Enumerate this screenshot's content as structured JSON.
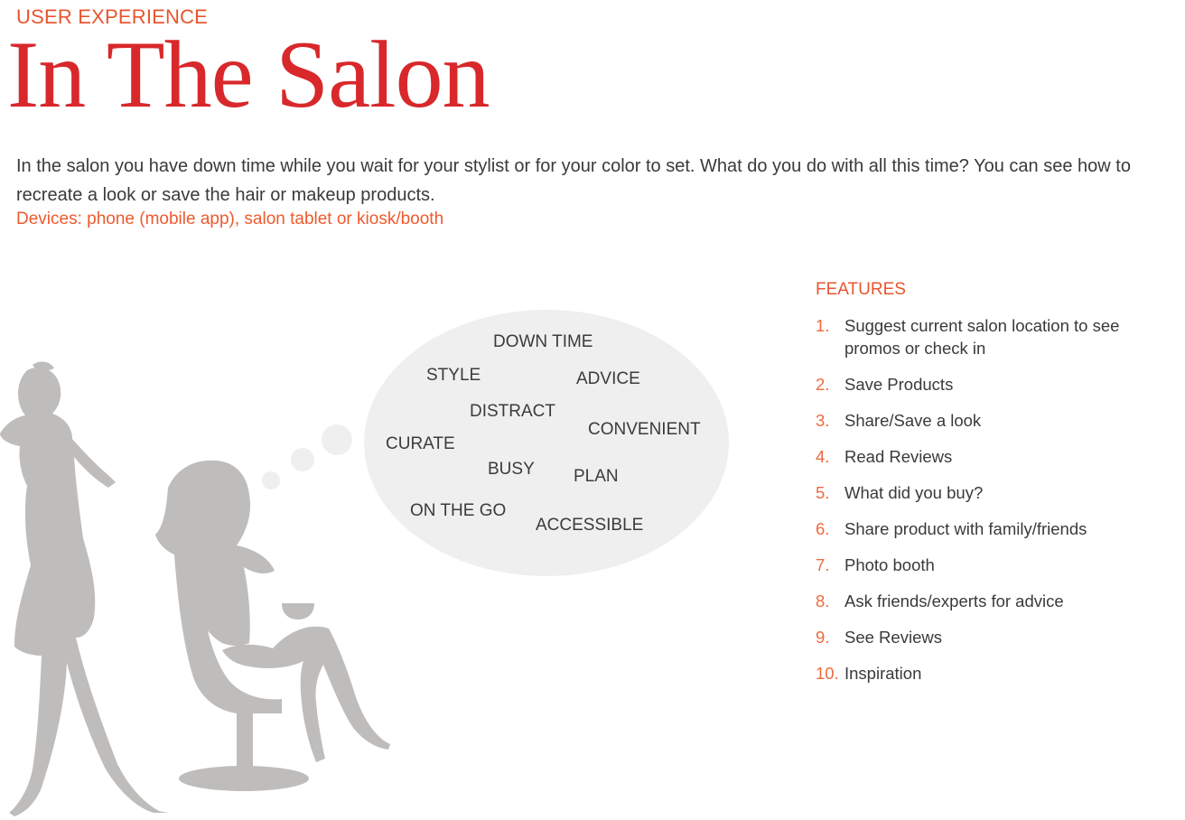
{
  "header": {
    "kicker": "USER EXPERIENCE",
    "title": "In The Salon"
  },
  "intro": {
    "text": "In the salon you have down time while you wait for your stylist or for your color to set. What do you do with all this time? You can see how to recreate a look or save the hair or makeup products.",
    "devices": "Devices: phone (mobile app), salon tablet or kiosk/booth"
  },
  "thought_bubble": {
    "words": [
      "DOWN TIME",
      "STYLE",
      "ADVICE",
      "DISTRACT",
      "CONVENIENT",
      "CURATE",
      "BUSY",
      "PLAN",
      "ON THE GO",
      "ACCESSIBLE"
    ]
  },
  "features": {
    "heading": "FEATURES",
    "items": [
      {
        "num": "1.",
        "text": "Suggest current salon location to see promos or check in"
      },
      {
        "num": "2.",
        "text": "Save Products"
      },
      {
        "num": "3.",
        "text": "Share/Save a look"
      },
      {
        "num": "4.",
        "text": "Read Reviews"
      },
      {
        "num": "5.",
        "text": "What did you buy?"
      },
      {
        "num": "6.",
        "text": "Share product with family/friends"
      },
      {
        "num": "7.",
        "text": "Photo booth"
      },
      {
        "num": "8.",
        "text": "Ask friends/experts for advice"
      },
      {
        "num": "9.",
        "text": "See Reviews"
      },
      {
        "num": "10.",
        "text": "Inspiration"
      }
    ]
  },
  "colors": {
    "title": "#d8282b",
    "accent": "#e8552f",
    "silhouette": "#bfbdbb",
    "bubble": "#efefef"
  },
  "illustration": {
    "icon": "salon-stylist-and-client-silhouette-icon"
  }
}
